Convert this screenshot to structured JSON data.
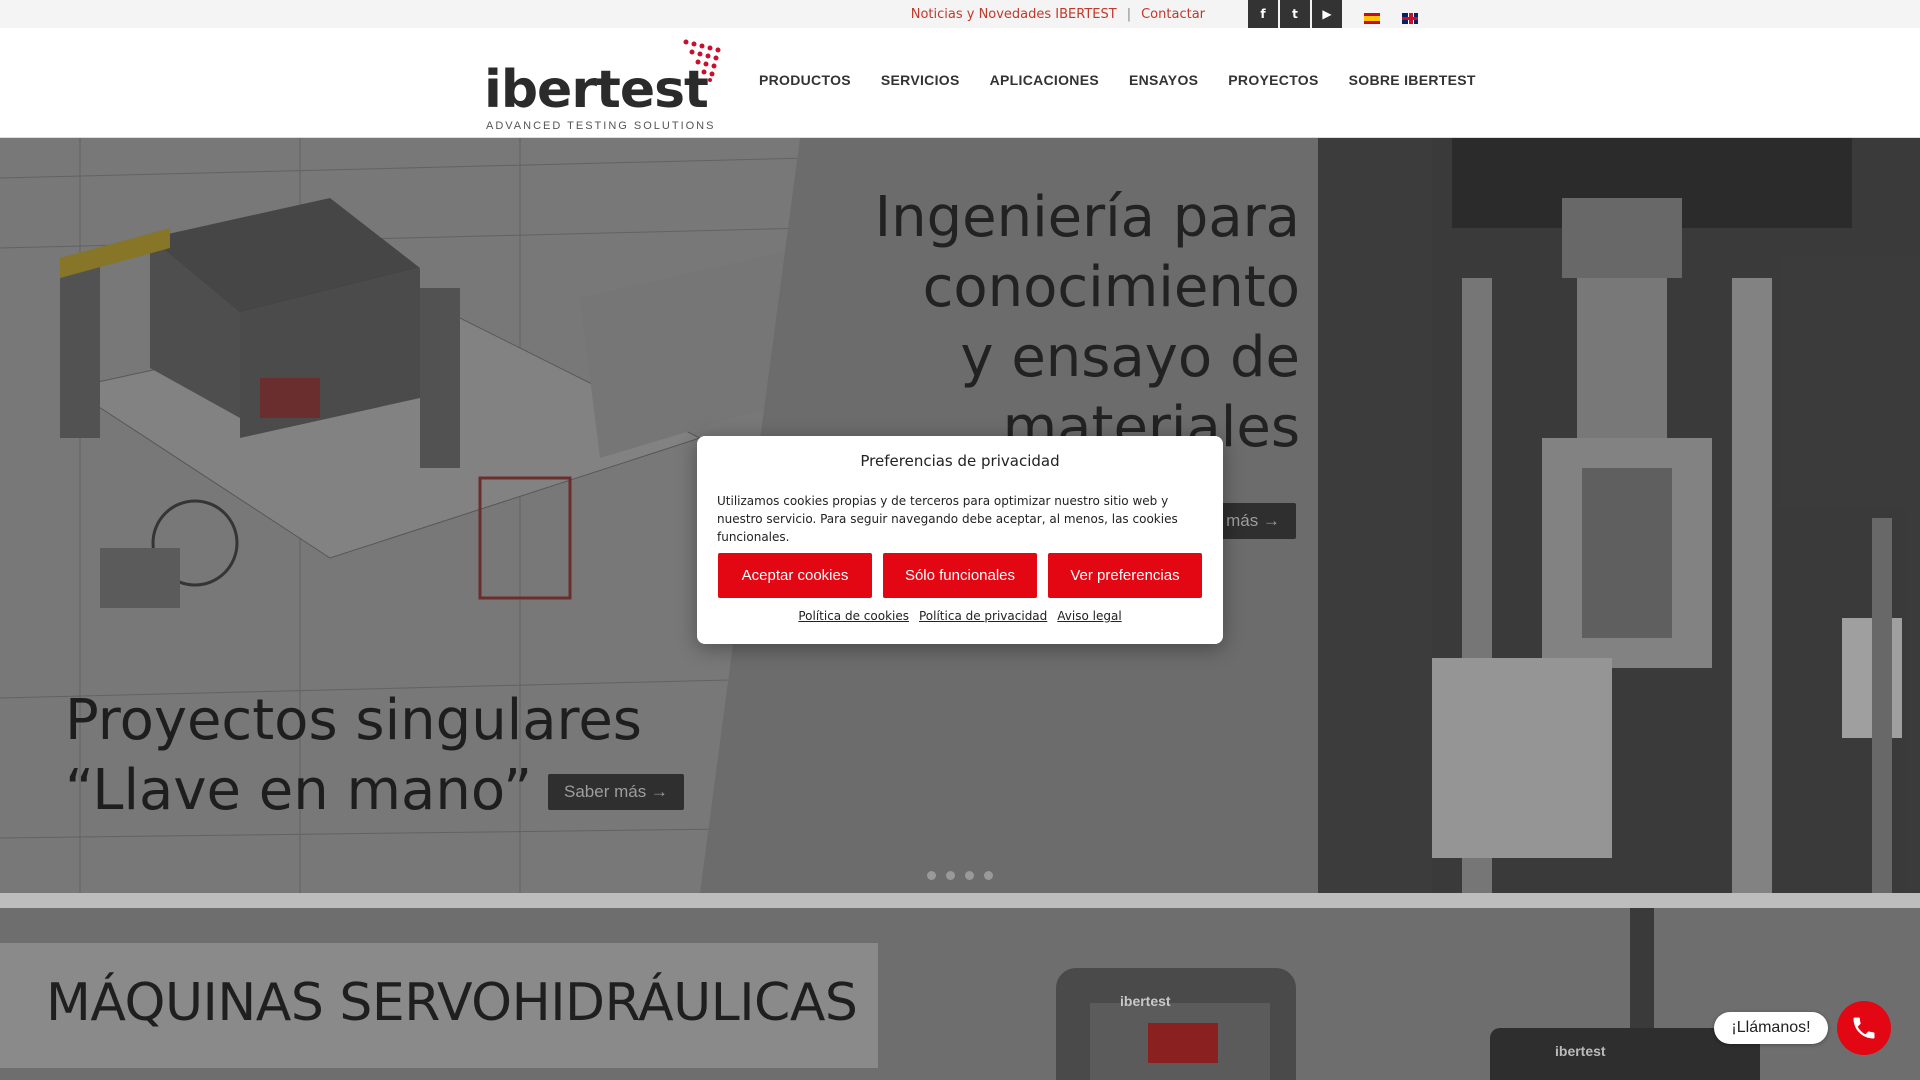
{
  "topbar": {
    "news_link": "Noticias y Novedades IBERTEST",
    "separator": "|",
    "contact_link": "Contactar",
    "socials": [
      "f",
      "t",
      "▶"
    ],
    "languages": [
      "es",
      "en"
    ]
  },
  "header": {
    "logo_text": "ibertest",
    "logo_tagline": "ADVANCED TESTING SOLUTIONS",
    "nav": [
      "PRODUCTOS",
      "SERVICIOS",
      "APLICACIONES",
      "ENSAYOS",
      "PROYECTOS",
      "SOBRE IBERTEST"
    ]
  },
  "hero": {
    "title_right_lines": [
      "Ingeniería para",
      "conocimiento",
      "y ensayo de",
      "materiales"
    ],
    "button_right": "Saber más →",
    "title_left_lines": [
      "Proyectos singulares",
      "“Llave en mano”"
    ],
    "button_left": "Saber más →",
    "slide_count": 4,
    "machine_brand": "ibertest"
  },
  "section2": {
    "title": "MÁQUINAS SERVOHIDRÁULICAS",
    "machine_brand": "ibertest"
  },
  "cookie_modal": {
    "title": "Preferencias de privacidad",
    "text": "Utilizamos cookies propias y de terceros para optimizar nuestro sitio web y nuestro servicio. Para seguir navegando debe aceptar, al menos, las cookies funcionales.",
    "accept_button": "Aceptar cookies",
    "functional_button": "Sólo funcionales",
    "preferences_button": "Ver preferencias",
    "links": [
      "Política de cookies",
      "Política de privacidad",
      "Aviso legal"
    ]
  },
  "call_widget": {
    "label": "¡Llámanos!"
  },
  "colors": {
    "accent": "#e30613",
    "dark": "#2f2f2f"
  }
}
